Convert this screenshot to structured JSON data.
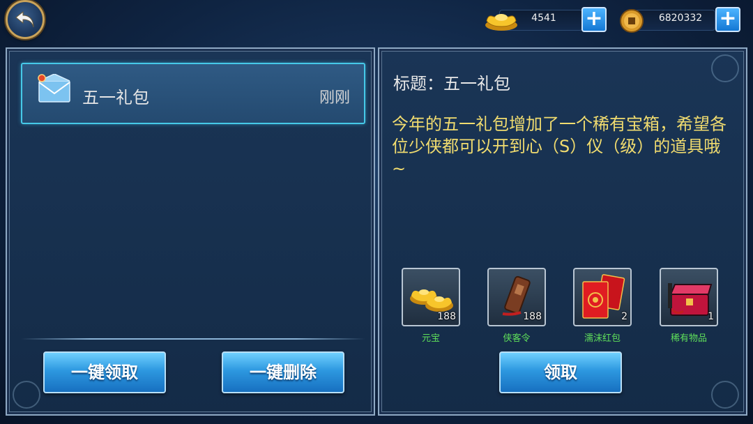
{
  "header": {
    "back_icon": "back-arrow-icon",
    "ingot": {
      "icon": "gold-ingot-icon",
      "value": "4541"
    },
    "copper": {
      "icon": "copper-coin-icon",
      "value": "6820332"
    },
    "plus_label": "+"
  },
  "mail_list": {
    "items": [
      {
        "icon": "envelope-icon",
        "title": "五一礼包",
        "time": "刚刚",
        "unread": true
      }
    ],
    "claim_all_label": "一键领取",
    "delete_all_label": "一键删除"
  },
  "mail_detail": {
    "subject": "标题：五一礼包",
    "body": "今年的五一礼包增加了一个稀有宝箱，希望各位少侠都可以开到心（S）仪（级）的道具哦~",
    "rewards": [
      {
        "icon": "gold-ingot-icon",
        "qty": "188",
        "name": "元宝"
      },
      {
        "icon": "token-plate-icon",
        "qty": "188",
        "name": "侠客令"
      },
      {
        "icon": "red-envelope-icon",
        "qty": "2",
        "name": "濡沫红包"
      },
      {
        "icon": "treasure-chest-icon",
        "qty": "1",
        "name": "稀有物品"
      }
    ],
    "claim_label": "领取"
  },
  "colors": {
    "accent_blue": "#2d98e0",
    "highlight_border": "#46c9e8",
    "body_text": "#f1dc6f",
    "reward_name": "#5fe05a"
  }
}
